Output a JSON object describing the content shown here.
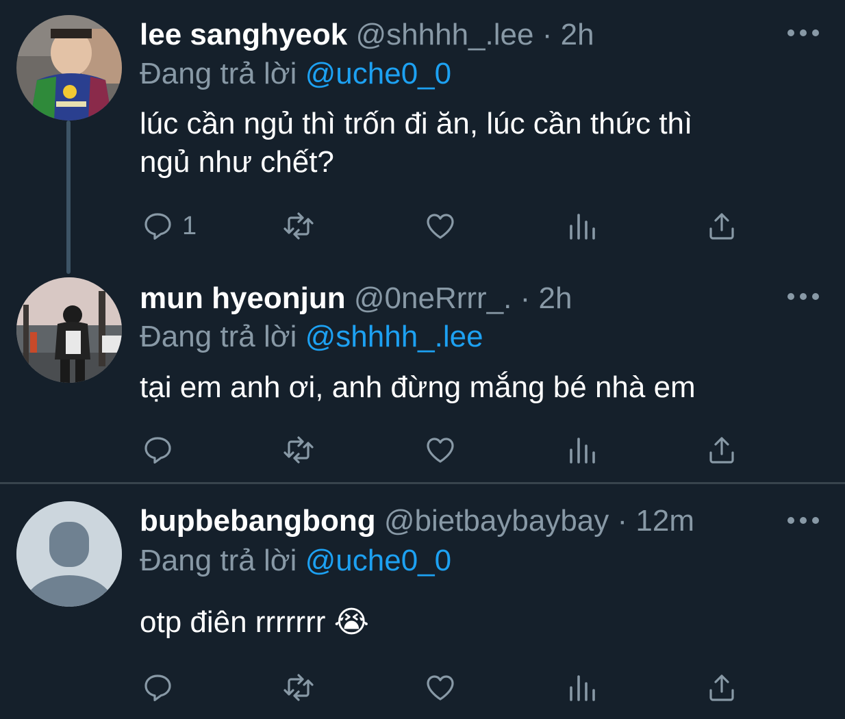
{
  "tweets": [
    {
      "display_name": "lee sanghyeok",
      "handle": "@shhhh_.lee",
      "separator": "·",
      "time": "2h",
      "reply_prefix": "Đang trả lời",
      "reply_to": "@uche0_0",
      "body_lines": [
        "lúc cần ngủ thì trốn đi ăn, lúc cần thức thì",
        "ngủ như chết?"
      ],
      "reply_count": "1"
    },
    {
      "display_name": "mun hyeonjun",
      "handle": "@0neRrrr_.",
      "separator": "·",
      "time": "2h",
      "reply_prefix": "Đang trả lời",
      "reply_to": "@shhhh_.lee",
      "body_lines": [
        "tại em anh ơi, anh đừng mắng bé nhà em"
      ],
      "reply_count": ""
    },
    {
      "display_name": "bupbebangbong",
      "handle": "@bietbaybaybay",
      "separator": "·",
      "time": "12m",
      "reply_prefix": "Đang trả lời",
      "reply_to": "@uche0_0",
      "body_lines": [
        "otp điên rrrrrrr"
      ],
      "emoji": "😭",
      "reply_count": ""
    }
  ],
  "icons": {
    "reply": "reply-icon",
    "retweet": "retweet-icon",
    "like": "heart-icon",
    "analytics": "analytics-icon",
    "share": "share-icon",
    "more": "more-icon"
  },
  "colors": {
    "background": "#15202b",
    "muted": "#8899a6",
    "mention": "#1da1f2",
    "divider": "#38444d",
    "thread_line": "#3d5466"
  }
}
